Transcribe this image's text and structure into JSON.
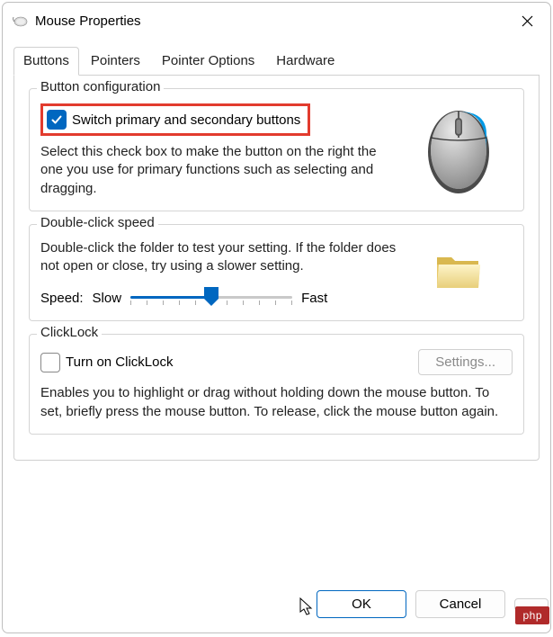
{
  "window": {
    "title": "Mouse Properties"
  },
  "tabs": {
    "buttons": "Buttons",
    "pointers": "Pointers",
    "pointer_options": "Pointer Options",
    "hardware": "Hardware"
  },
  "button_config": {
    "title": "Button configuration",
    "switch_label": "Switch primary and secondary buttons",
    "switch_checked": true,
    "description": "Select this check box to make the button on the right the one you use for primary functions such as selecting and dragging."
  },
  "double_click": {
    "title": "Double-click speed",
    "description": "Double-click the folder to test your setting. If the folder does not open or close, try using a slower setting.",
    "speed_label": "Speed:",
    "slow_label": "Slow",
    "fast_label": "Fast",
    "slider_value": 0.5
  },
  "clicklock": {
    "title": "ClickLock",
    "turn_on_label": "Turn on ClickLock",
    "turn_on_checked": false,
    "settings_label": "Settings...",
    "description": "Enables you to highlight or drag without holding down the mouse button. To set, briefly press the mouse button. To release, click the mouse button again."
  },
  "buttons_row": {
    "ok": "OK",
    "cancel": "Cancel"
  },
  "watermark": "php"
}
